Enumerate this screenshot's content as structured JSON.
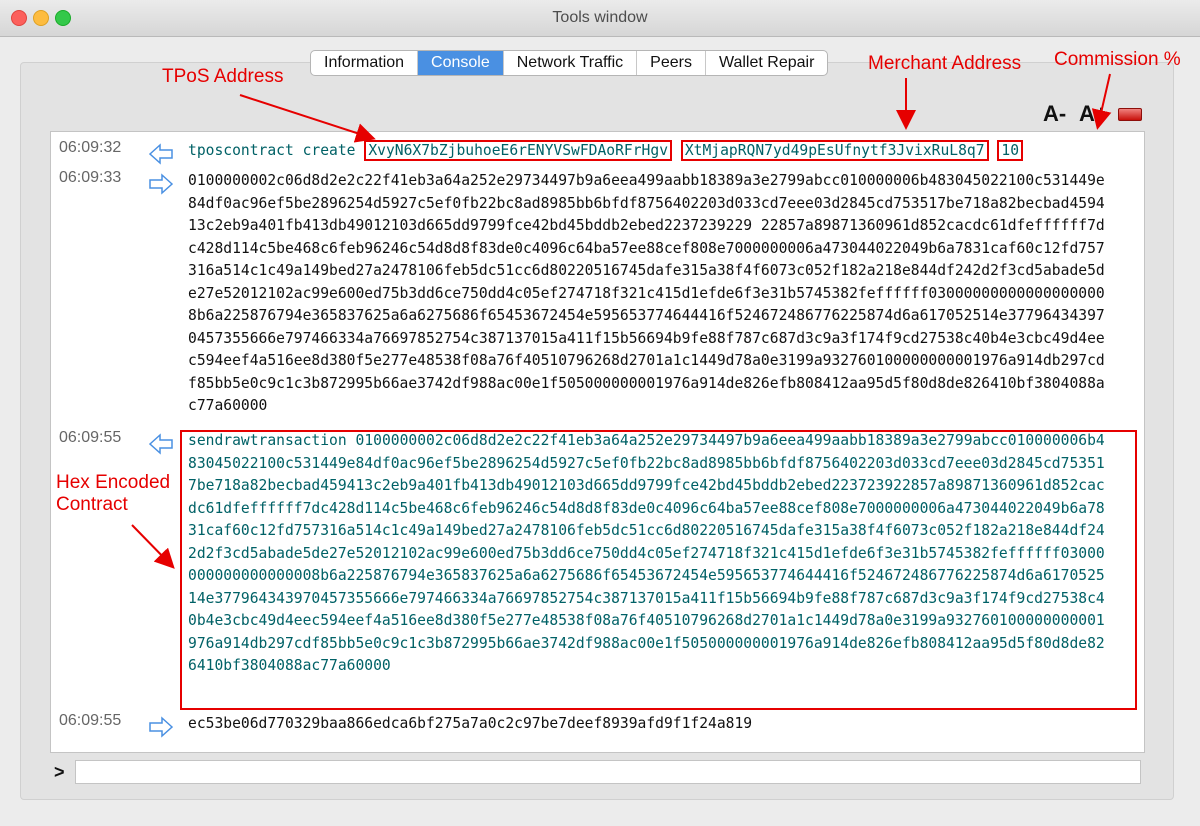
{
  "window": {
    "title": "Tools window"
  },
  "tabs": [
    {
      "label": "Information",
      "active": false
    },
    {
      "label": "Console",
      "active": true
    },
    {
      "label": "Network Traffic",
      "active": false
    },
    {
      "label": "Peers",
      "active": false
    },
    {
      "label": "Wallet Repair",
      "active": false
    }
  ],
  "toolbar": {
    "font_smaller": "A-",
    "font_larger": "A+"
  },
  "console": {
    "entries": [
      {
        "time": "06:09:32",
        "direction": "input",
        "command": "tposcontract create",
        "tpos_address": "XvyN6X7bZjbuhoeE6rENYVSwFDAoRFrHgv",
        "merchant_address": "XtMjapRQN7yd49pEsUfnytf3JvixRuL8q7",
        "commission": "10"
      },
      {
        "time": "06:09:33",
        "direction": "output",
        "text": "0100000002c06d8d2e2c22f41eb3a64a252e29734497b9a6eea499aabb18389a3e2799abcc010000006b483045022100c531449e84df0ac96ef5be2896254d5927c5ef0fb22bc8ad8985bb6bfdf8756402203d033cd7eee03d2845cd753517be718a82becbad459413c2eb9a401fb413db49012103d665dd9799fce42bd45bddb2ebed2237239229 22857a89871360961d852cacdc61dfeffffff7dc428d114c5be468c6feb96246c54d8d8f83de0c4096c64ba57ee88cef808e7000000006a473044022049b6a7831caf60c12fd757316a514c1c49a149bed27a2478106feb5dc51cc6d80220516745dafe315a38f4f6073c052f182a218e844df242d2f3cd5abade5de27e52012102ac99e600ed75b3dd6ce750dd4c05ef274718f321c415d1efde6f3e31b5745382feffffff030000000000000000008b6a225876794e365837625a6a6275686f65453672454e595653774644416f524672486776225874d6a617052514e377964343970457355666e797466334a76697852754c387137015a411f15b56694b9fe88f787c687d3c9a3f174f9cd27538c40b4e3cbc49d4eec594eef4a516ee8d380f5e277e48538f08a76f40510796268d2701a1c1449d78a0e3199a932760100000000001976a914db297cdf85bb5e0c9c1c3b872995b66ae3742df988ac00e1f505000000001976a914de826efb808412aa95d5f80d8de826410bf3804088ac77a60000"
      },
      {
        "time": "06:09:55",
        "direction": "input",
        "command": "sendrawtransaction",
        "text": "0100000002c06d8d2e2c22f41eb3a64a252e29734497b9a6eea499aabb18389a3e2799abcc010000006b483045022100c531449e84df0ac96ef5be2896254d5927c5ef0fb22bc8ad8985bb6bfdf8756402203d033cd7eee03d2845cd753517be718a82becbad459413c2eb9a401fb413db49012103d665dd9799fce42bd45bddb2ebed223723922857a89871360961d852cacdc61dfeffffff7dc428d114c5be468c6feb96246c54d8d8f83de0c4096c64ba57ee88cef808e7000000006a473044022049b6a7831caf60c12fd757316a514c1c49a149bed27a2478106feb5dc51cc6d80220516745dafe315a38f4f6073c052f182a218e844df242d2f3cd5abade5de27e52012102ac99e600ed75b3dd6ce750dd4c05ef274718f321c415d1efde6f3e31b5745382feffffff03000000000000000008b6a225876794e365837625a6a6275686f65453672454e595653774644416f524672486776225874d6a617052514e377964343970457355666e797466334a76697852754c387137015a411f15b56694b9fe88f787c687d3c9a3f174f9cd27538c40b4e3cbc49d4eec594eef4a516ee8d380f5e277e48538f08a76f40510796268d2701a1c1449d78a0e3199a932760100000000001976a914db297cdf85bb5e0c9c1c3b872995b66ae3742df988ac00e1f505000000001976a914de826efb808412aa95d5f80d8de826410bf3804088ac77a60000"
      },
      {
        "time": "06:09:55",
        "direction": "output",
        "text": "ec53be06d770329baa866edca6bf275a7a0c2c97be7deef8939afd9f1f24a819"
      }
    ],
    "prompt": ">",
    "input_value": ""
  },
  "annotations": {
    "tpos_address": "TPoS Address",
    "merchant_address": "Merchant Address",
    "commission": "Commission %",
    "hex_contract": "Hex Encoded Contract"
  },
  "colors": {
    "annotation": "#e60000",
    "command_text": "#006166",
    "tab_active": "#4a90e2",
    "arrow": "#4a90e2"
  }
}
